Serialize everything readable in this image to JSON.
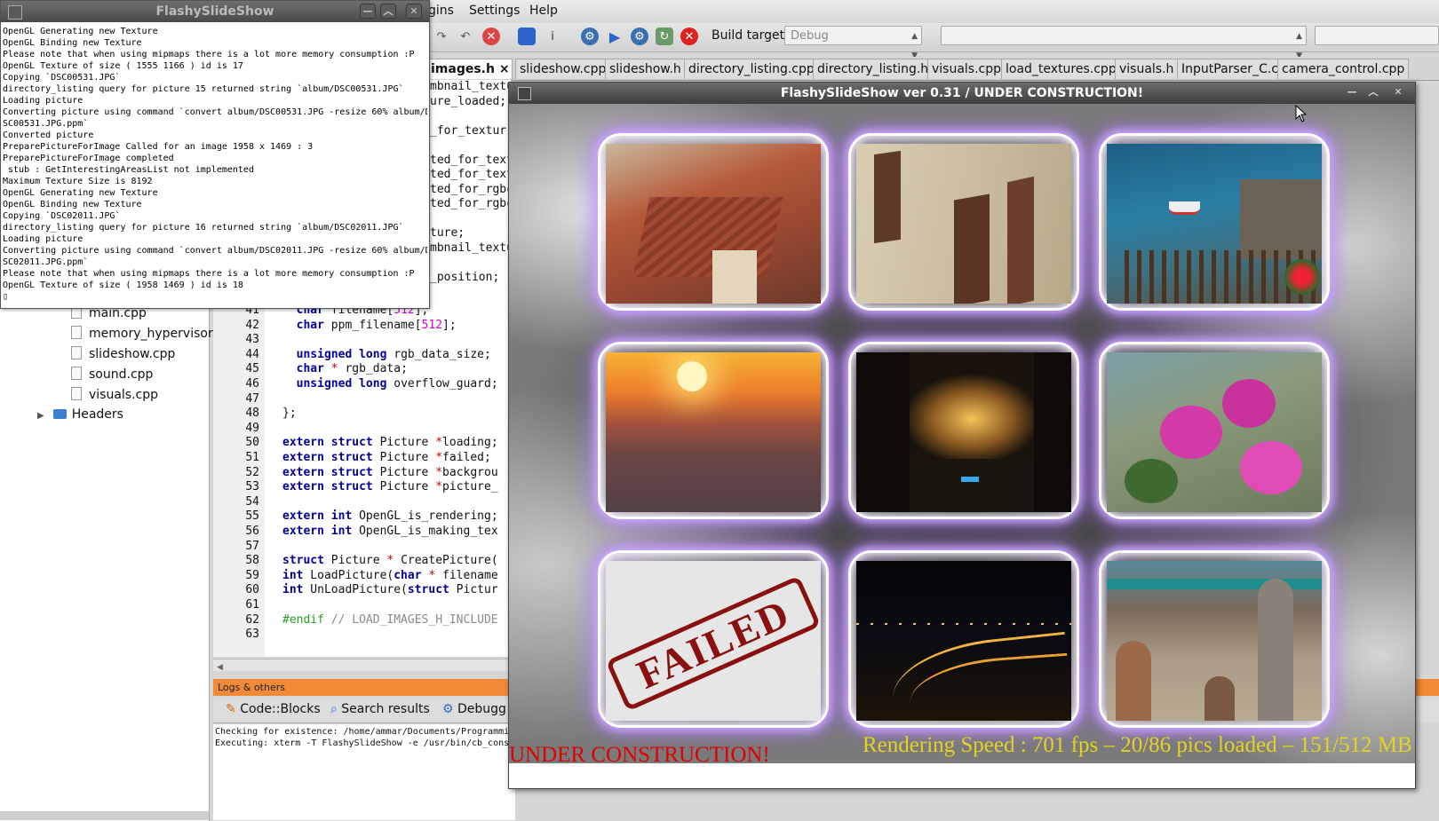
{
  "ide": {
    "menu": [
      "gins",
      "Settings",
      "Help"
    ],
    "build_target_label": "Build target:",
    "build_target_value": "Debug",
    "tabs": [
      "images.h",
      "slideshow.cpp",
      "slideshow.h",
      "directory_listing.cpp",
      "directory_listing.h",
      "visuals.cpp",
      "load_textures.cpp",
      "visuals.h",
      "InputParser_C.c",
      "camera_control.cpp"
    ],
    "active_tab_close": "×",
    "tree": {
      "files": [
        "main.cpp",
        "memory_hypervisor.",
        "slideshow.cpp",
        "sound.cpp",
        "visuals.cpp"
      ],
      "folder": "Headers"
    },
    "code_snippets_top": [
      "mbnail_textu",
      "ure_loaded;",
      "",
      "_for_textur",
      "",
      "ted_for_text",
      "ted_for_text",
      "ted_for_rgbc",
      "ted_for_rgbc",
      "",
      "ture;",
      "mbnail_textu",
      "",
      "_position;"
    ],
    "code_lines": [
      {
        "n": "41",
        "text": "  char filename[512];"
      },
      {
        "n": "42",
        "text": "  char ppm_filename[512];"
      },
      {
        "n": "43",
        "text": ""
      },
      {
        "n": "44",
        "text": "  unsigned long rgb_data_size;"
      },
      {
        "n": "45",
        "text": "  char * rgb_data;"
      },
      {
        "n": "46",
        "text": "  unsigned long overflow_guard;"
      },
      {
        "n": "47",
        "text": ""
      },
      {
        "n": "48",
        "text": "};"
      },
      {
        "n": "49",
        "text": ""
      },
      {
        "n": "50",
        "text": "extern struct Picture *loading;"
      },
      {
        "n": "51",
        "text": "extern struct Picture *failed;"
      },
      {
        "n": "52",
        "text": "extern struct Picture *backgrou"
      },
      {
        "n": "53",
        "text": "extern struct Picture *picture_"
      },
      {
        "n": "54",
        "text": ""
      },
      {
        "n": "55",
        "text": "extern int OpenGL_is_rendering;"
      },
      {
        "n": "56",
        "text": "extern int OpenGL_is_making_tex"
      },
      {
        "n": "57",
        "text": ""
      },
      {
        "n": "58",
        "text": "struct Picture * CreatePicture("
      },
      {
        "n": "59",
        "text": "int LoadPicture(char * filename"
      },
      {
        "n": "60",
        "text": "int UnLoadPicture(struct Pictur"
      },
      {
        "n": "61",
        "text": ""
      },
      {
        "n": "62",
        "text": "#endif // LOAD_IMAGES_H_INCLUDE"
      },
      {
        "n": "63",
        "text": ""
      }
    ],
    "logs": {
      "header": "Logs & others",
      "tabs": [
        "Code::Blocks",
        "Search results",
        "Debugg"
      ],
      "lines": [
        "Checking for existence: /home/ammar/Documents/Programmi",
        "Executing: xterm -T FlashySlideShow -e /usr/bin/cb_cons"
      ]
    }
  },
  "terminal": {
    "title": "FlashySlideShow",
    "lines": [
      "OpenGL Generating new Texture",
      "OpenGL Binding new Texture",
      "Please note that when using mipmaps there is a lot more memory consumption :P",
      "OpenGL Texture of size ( 1555 1166 ) id is 17",
      "Copying `DSC00531.JPG`",
      "directory_listing query for picture 15 returned string `album/DSC00531.JPG`",
      "Loading picture",
      "Converting picture using command `convert album/DSC00531.JPG -resize 60% album/D",
      "SC00531.JPG.ppm`",
      "Converted picture",
      "PreparePictureForImage Called for an image 1958 x 1469 : 3",
      "PreparePictureForImage completed",
      " stub : GetInterestingAreasList not implemented",
      "Maximum Texture Size is 8192",
      "OpenGL Generating new Texture",
      "OpenGL Binding new Texture",
      "Copying `DSC02011.JPG`",
      "directory_listing query for picture 16 returned string `album/DSC02011.JPG`",
      "Loading picture",
      "Converting picture using command `convert album/DSC02011.JPG -resize 60% album/D",
      "SC02011.JPG.ppm`",
      "Please note that when using mipmaps there is a lot more memory consumption :P",
      "OpenGL Texture of size ( 1958 1469 ) id is 18",
      "▯"
    ]
  },
  "slideshow": {
    "title": "FlashySlideShow ver 0.31 / UNDER CONSTRUCTION!",
    "status_left": "UNDER CONSTRUCTION!",
    "status_right": "Rendering Speed : 701 fps – 20/86 pics loaded – 151/512 MB",
    "failed_stamp": "FAILED",
    "thumbnails": [
      "rooftops",
      "building-wall",
      "coast-boat",
      "sunset",
      "car-interior",
      "bougainvillea",
      "failed",
      "night-road",
      "street-people"
    ]
  },
  "colors": {
    "status_left": "#e00000",
    "status_right": "#e3d41e",
    "frame_glow": "#b080ff",
    "logs_header": "#f08a36"
  }
}
